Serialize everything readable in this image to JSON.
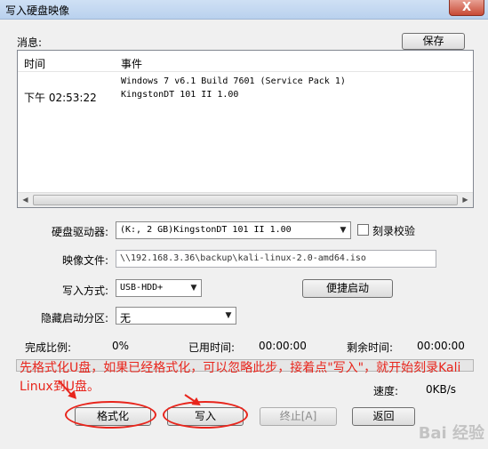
{
  "window": {
    "title": "写入硬盘映像",
    "close_label": "X"
  },
  "log": {
    "label": "消息:",
    "save_label": "保存",
    "columns": {
      "time": "时间",
      "event": "事件"
    },
    "rows": [
      {
        "time": "",
        "event": "Windows 7 v6.1 Build 7601  (Service Pack 1)"
      },
      {
        "time": "下午 02:53:22",
        "event": "KingstonDT 101 II       1.00"
      }
    ]
  },
  "form": {
    "drive_label": "硬盘驱动器:",
    "drive_value": "(K:, 2 GB)KingstonDT 101 II        1.00",
    "verify_label": "刻录校验",
    "image_label": "映像文件:",
    "image_value": "\\\\192.168.3.36\\backup\\kali-linux-2.0-amd64.iso",
    "method_label": "写入方式:",
    "method_value": "USB-HDD+",
    "quickboot_label": "便捷启动",
    "hidden_label": "隐藏启动分区:",
    "hidden_value": "无"
  },
  "status": {
    "percent_label": "完成比例:",
    "percent_value": "0%",
    "elapsed_label": "已用时间:",
    "elapsed_value": "00:00:00",
    "remaining_label": "剩余时间:",
    "remaining_value": "00:00:00",
    "speed_label": "速度:",
    "speed_value": "0KB/s",
    "progress_fraction": 0
  },
  "buttons": {
    "format": "格式化",
    "write": "写入",
    "abort": "终止[A]",
    "back": "返回"
  },
  "annotation": {
    "text": "先格式化U盘，如果已经格式化，可以忽略此步，接着点\"写入\"，就开始刻录Kali Linux到U盘。",
    "color": "#e8251c"
  },
  "watermark": "Bai 经验"
}
